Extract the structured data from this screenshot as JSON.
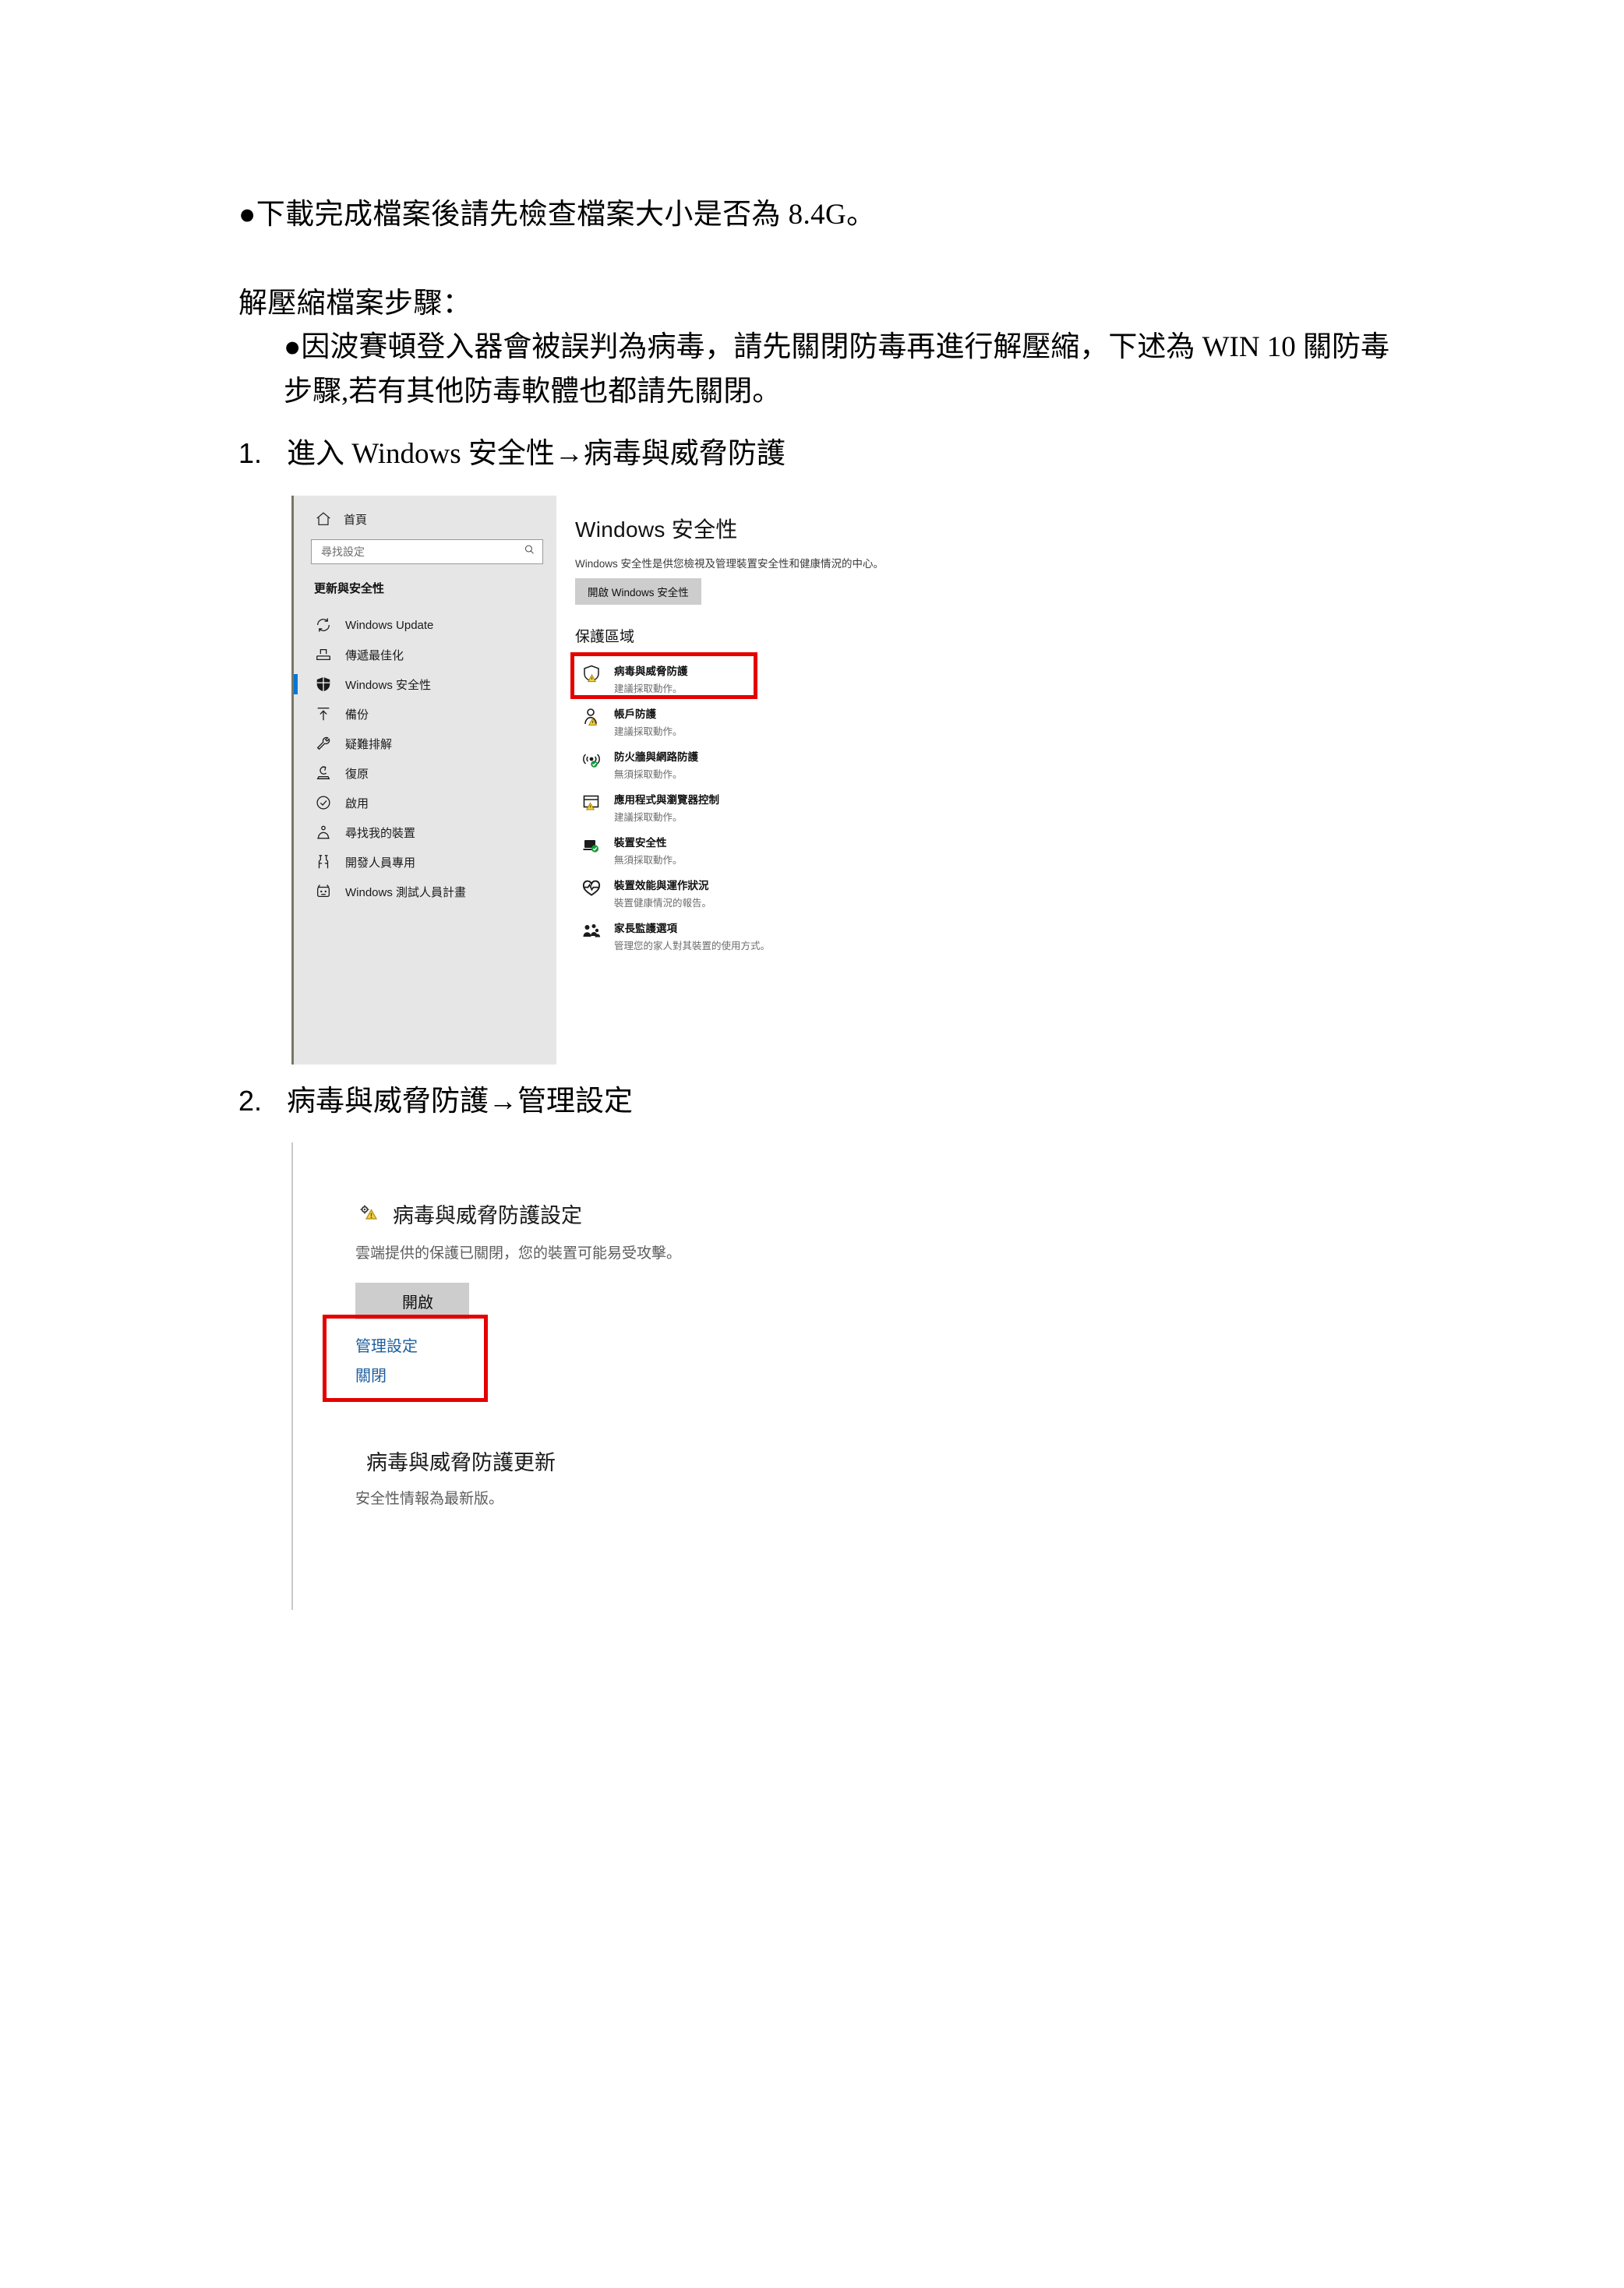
{
  "document": {
    "line1": "●下載完成檔案後請先檢查檔案大小是否為 8.4G。",
    "line2": "解壓縮檔案步驟：",
    "line3": "●因波賽頓登入器會被誤判為病毒，請先關閉防毒再進行解壓縮，下述為 WIN 10 關防毒步驟,若有其他防毒軟體也都請先關閉。",
    "step1_num": "1.",
    "step1_text": "進入 Windows 安全性→病毒與威脅防護",
    "step2_num": "2.",
    "step2_text": "病毒與威脅防護→管理設定"
  },
  "settings_window": {
    "home_label": "首頁",
    "search_placeholder": "尋找設定",
    "section_header": "更新與安全性",
    "nav_items": [
      {
        "label": "Windows Update",
        "icon": "sync-icon",
        "selected": false
      },
      {
        "label": "傳遞最佳化",
        "icon": "delivery-optimization-icon",
        "selected": false
      },
      {
        "label": "Windows 安全性",
        "icon": "shield-icon",
        "selected": true
      },
      {
        "label": "備份",
        "icon": "backup-upload-icon",
        "selected": false
      },
      {
        "label": "疑難排解",
        "icon": "wrench-icon",
        "selected": false
      },
      {
        "label": "復原",
        "icon": "recovery-icon",
        "selected": false
      },
      {
        "label": "啟用",
        "icon": "check-circle-icon",
        "selected": false
      },
      {
        "label": "尋找我的裝置",
        "icon": "find-my-device-icon",
        "selected": false
      },
      {
        "label": "開發人員專用",
        "icon": "developer-tools-icon",
        "selected": false
      },
      {
        "label": "Windows 測試人員計畫",
        "icon": "insider-icon",
        "selected": false
      }
    ],
    "page_title": "Windows 安全性",
    "page_desc": "Windows 安全性是供您檢視及管理裝置安全性和健康情況的中心。",
    "open_button": "開啟 Windows 安全性",
    "protection_section": "保護區域",
    "protection_areas": [
      {
        "name": "病毒與威脅防護",
        "status": "建議採取動作。",
        "icon": "shield-warning-icon",
        "badge": "warning",
        "highlighted": true
      },
      {
        "name": "帳戶防護",
        "status": "建議採取動作。",
        "icon": "account-person-icon",
        "badge": "warning",
        "highlighted": false
      },
      {
        "name": "防火牆與網路防護",
        "status": "無須採取動作。",
        "icon": "firewall-network-icon",
        "badge": "ok",
        "highlighted": false
      },
      {
        "name": "應用程式與瀏覽器控制",
        "status": "建議採取動作。",
        "icon": "app-browser-icon",
        "badge": "warning",
        "highlighted": false
      },
      {
        "name": "裝置安全性",
        "status": "無須採取動作。",
        "icon": "device-security-icon",
        "badge": "ok",
        "highlighted": false
      },
      {
        "name": "裝置效能與運作狀況",
        "status": "裝置健康情況的報告。",
        "icon": "heart-pulse-icon",
        "badge": "none",
        "highlighted": false
      },
      {
        "name": "家長監護選項",
        "status": "管理您的家人對其裝置的使用方式。",
        "icon": "family-people-icon",
        "badge": "none",
        "highlighted": false
      }
    ]
  },
  "virus_settings_window": {
    "heading": "病毒與威脅防護設定",
    "heading_icon": "settings-gear-warning-icon",
    "description": "雲端提供的保護已關閉，您的裝置可能易受攻擊。",
    "turn_on_button": "開啟",
    "manage_link": "管理設定",
    "close_link": "關閉",
    "update_heading": "病毒與威脅防護更新",
    "update_heading_icon": "sync-check-icon",
    "update_description": "安全性情報為最新版。"
  },
  "colors": {
    "accent_blue": "#0078d7",
    "highlight_red": "#e50000",
    "link_blue": "#1f5f9e",
    "warning_yellow": "#e8b71b",
    "ok_green": "#149a3a",
    "sidebar_bg": "#e6e6e6",
    "button_gray": "#cdcdcd"
  }
}
